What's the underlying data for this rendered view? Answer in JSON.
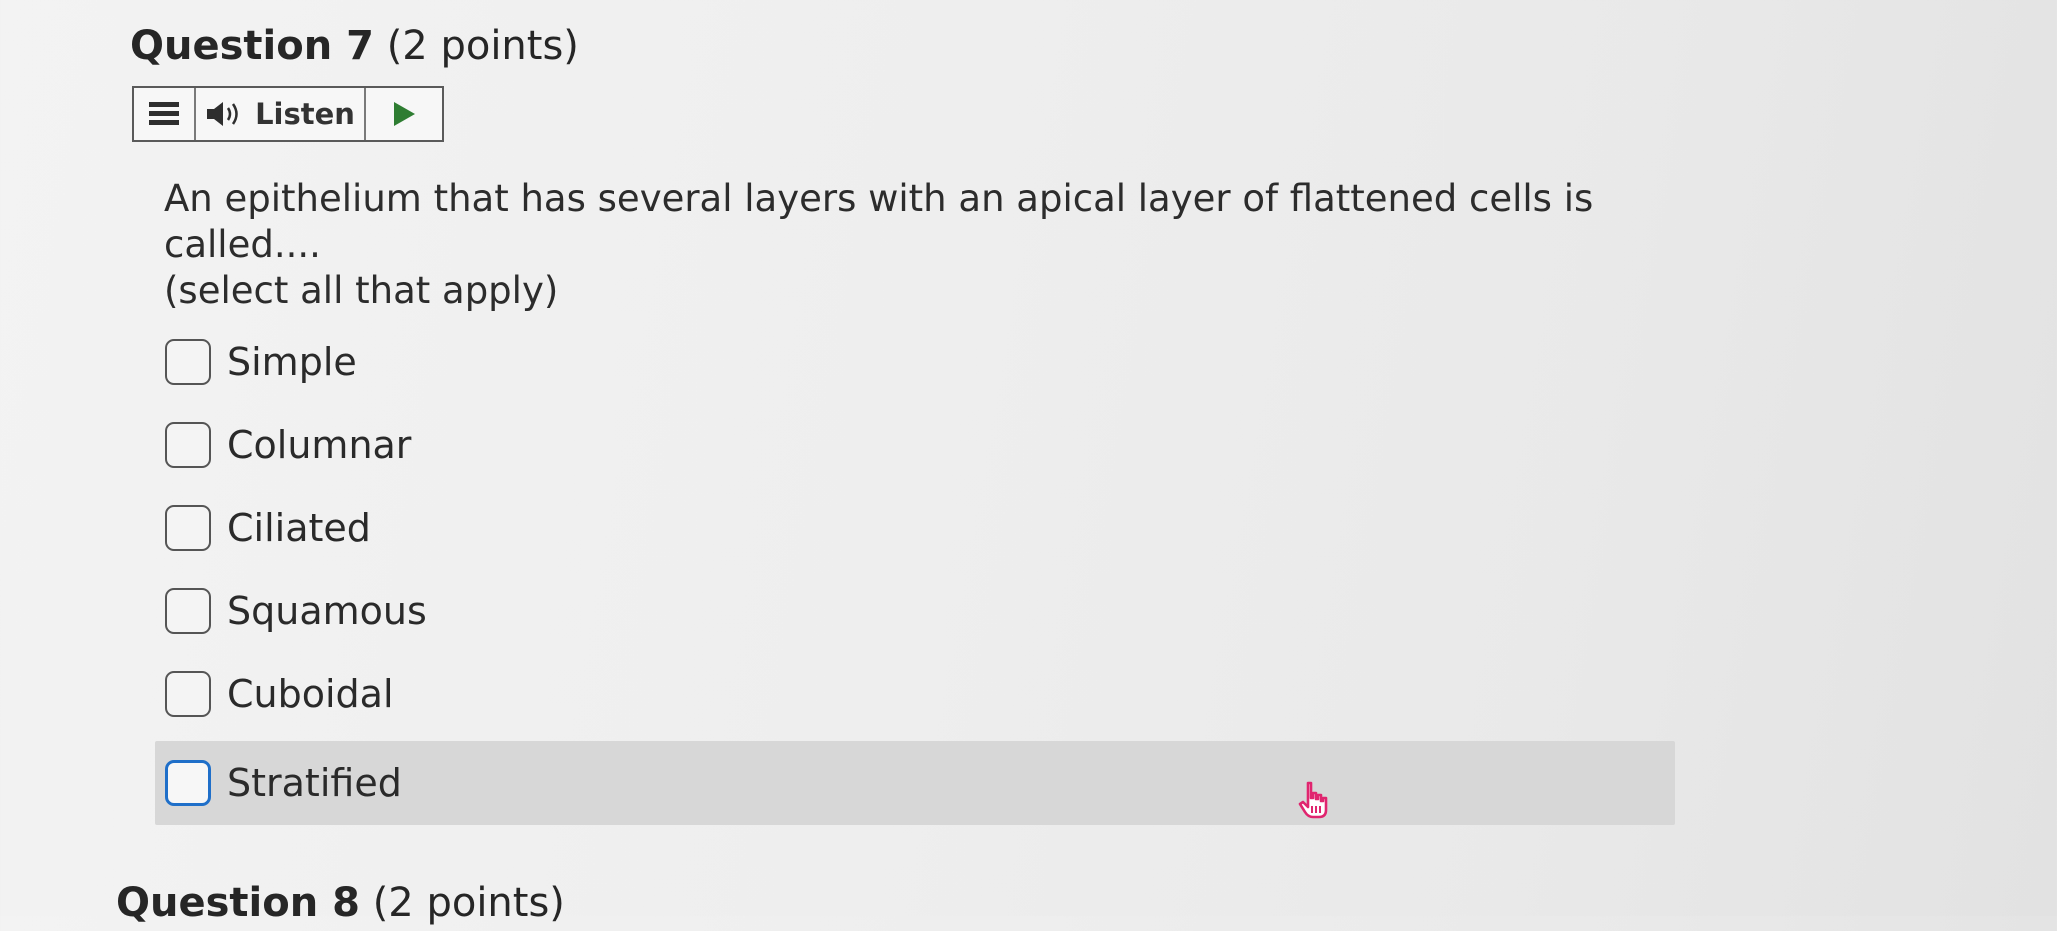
{
  "question": {
    "number_label": "Question 7",
    "points_label": "(2 points)",
    "prompt_line1": "An epithelium that has several layers with an apical layer of flattened cells is called....",
    "prompt_line2": "(select all that apply)"
  },
  "listen_toolbar": {
    "menu_icon": "menu-icon",
    "speaker_icon": "speaker-icon",
    "listen_label": "Listen",
    "play_icon": "play-icon",
    "play_color": "#2e7d32"
  },
  "options": [
    {
      "label": "Simple",
      "checked": false
    },
    {
      "label": "Columnar",
      "checked": false
    },
    {
      "label": "Ciliated",
      "checked": false
    },
    {
      "label": "Squamous",
      "checked": false
    },
    {
      "label": "Cuboidal",
      "checked": false
    },
    {
      "label": "Stratified",
      "checked": false,
      "focused": true
    }
  ],
  "focus_color": "#1f6fc9",
  "cursor_color": "#e0256f",
  "next_question": {
    "number_label": "Question 8",
    "points_label": "(2 points)"
  }
}
